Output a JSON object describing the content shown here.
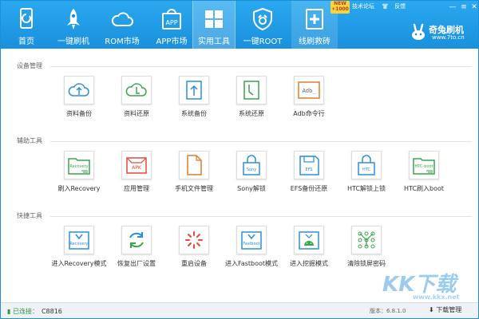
{
  "nav": {
    "items": [
      {
        "label": "首页"
      },
      {
        "label": "一键刷机"
      },
      {
        "label": "ROM市场"
      },
      {
        "label": "APP市场"
      },
      {
        "label": "实用工具"
      },
      {
        "label": "一键ROOT"
      },
      {
        "label": "线刷救砖"
      }
    ],
    "app_icon_text": "APP",
    "new_badge": "NEW +1000"
  },
  "system_links": {
    "forum": "技术论坛",
    "feedback": "反馈"
  },
  "brand": {
    "name": "奇兔刷机",
    "url": "www.7to.cn"
  },
  "sections": {
    "device": {
      "title": "设备管理",
      "tools": [
        {
          "label": "资料备份",
          "icon": "cloud-upload-icon"
        },
        {
          "label": "资料还原",
          "icon": "cloud-restore-icon"
        },
        {
          "label": "系统备份",
          "icon": "system-backup-icon"
        },
        {
          "label": "系统还原",
          "icon": "system-restore-icon"
        },
        {
          "label": "Adb命令行",
          "icon": "adb-terminal-icon",
          "icon_text": "Adb_"
        }
      ]
    },
    "assist": {
      "title": "辅助工具",
      "tools": [
        {
          "label": "刷入Recovery",
          "icon": "recovery-folder-icon",
          "icon_text": "Recovery"
        },
        {
          "label": "应用管理",
          "icon": "apk-icon",
          "icon_text": "APK"
        },
        {
          "label": "手机文件管理",
          "icon": "file-icon"
        },
        {
          "label": "Sony解锁",
          "icon": "sony-lock-icon",
          "icon_text": "Sony"
        },
        {
          "label": "EFS备份还原",
          "icon": "efs-floppy-icon",
          "icon_text": "EFS"
        },
        {
          "label": "HTC解锁上锁",
          "icon": "htc-lock-icon",
          "icon_text": "HTC"
        },
        {
          "label": "HTC刷入boot",
          "icon": "htc-boot-icon",
          "icon_text": "HTC-boot"
        }
      ]
    },
    "quick": {
      "title": "快捷工具",
      "tools": [
        {
          "label": "进入Recovery模式",
          "icon": "recovery-mode-icon",
          "icon_text": "Recovery"
        },
        {
          "label": "恢复出厂设置",
          "icon": "factory-reset-icon"
        },
        {
          "label": "重启设备",
          "icon": "reboot-icon"
        },
        {
          "label": "进入Fastboot模式",
          "icon": "fastboot-icon",
          "icon_text": "Fastboot"
        },
        {
          "label": "进入挖掘模式",
          "icon": "android-dig-icon"
        },
        {
          "label": "清除锁屏密码",
          "icon": "pattern-lock-icon"
        }
      ]
    }
  },
  "status": {
    "connected": "已连接：",
    "device": "C8816",
    "version": "版本：6.8.1.0",
    "download": "下载管理"
  },
  "watermark": {
    "text": "KK下载",
    "url": "www.kkx.net"
  },
  "colors": {
    "topbar": "#1a90dc",
    "accent_green": "#2a9d3c",
    "icon_blue": "#2a8fd8",
    "icon_green": "#3aa44a",
    "icon_orange": "#e07b2a",
    "icon_red": "#e24a3b"
  }
}
